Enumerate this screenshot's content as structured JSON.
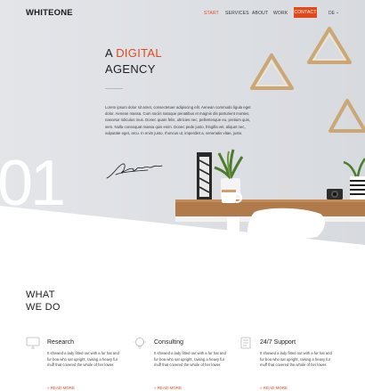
{
  "brand": {
    "logo": "WHITEONE"
  },
  "nav": {
    "items": [
      "START",
      "SERVICES",
      "ABOUT",
      "WORK"
    ],
    "contact": "CONTACT",
    "language": "DE",
    "accent_color": "#e1491d"
  },
  "hero": {
    "headline_prefix": "A",
    "headline_accent": "DIGITAL",
    "headline_line2": "AGENCY",
    "intro": "Lorem ipsum dolor sit amet, consectetuer adipiscing elit. Aenean commodo ligula eget dolor. Aenean massa. Cum sociis natoque penatibus et magnis dis parturient montes, nascetur ridiculus mus. Donec quam felis, ultricies nec, pellentesque eu, pretium quis, sem. Nulla consequat massa quis enim. Donec pede justo, fringilla vel, aliquet nec, vulputate eget, arcu. In enim justo, rhoncus ut, imperdiet a, venenatis vitae, justo.",
    "number": "01"
  },
  "section": {
    "title_line1": "WHAT",
    "title_line2": "WE DO"
  },
  "services": [
    {
      "title": "Research",
      "text": "It showed a lady fitted out with a fur hat and fur boa who sat upright, raising a heavy fur muff that covered the whole of her lower.",
      "link": "READ MORE",
      "icon": "monitor-icon"
    },
    {
      "title": "Consulting",
      "text": "It showed a lady fitted out with a fur hat and fur boa who sat upright, raising a heavy fur muff that covered the whole of her lower.",
      "link": "READ MORE",
      "icon": "lightbulb-icon"
    },
    {
      "title": "24/7 Support",
      "text": "It showed a lady fitted out with a fur hat and fur boa who sat upright, raising a heavy fur muff that covered the whole of her lower.",
      "link": "READ MORE",
      "icon": "document-icon"
    }
  ]
}
